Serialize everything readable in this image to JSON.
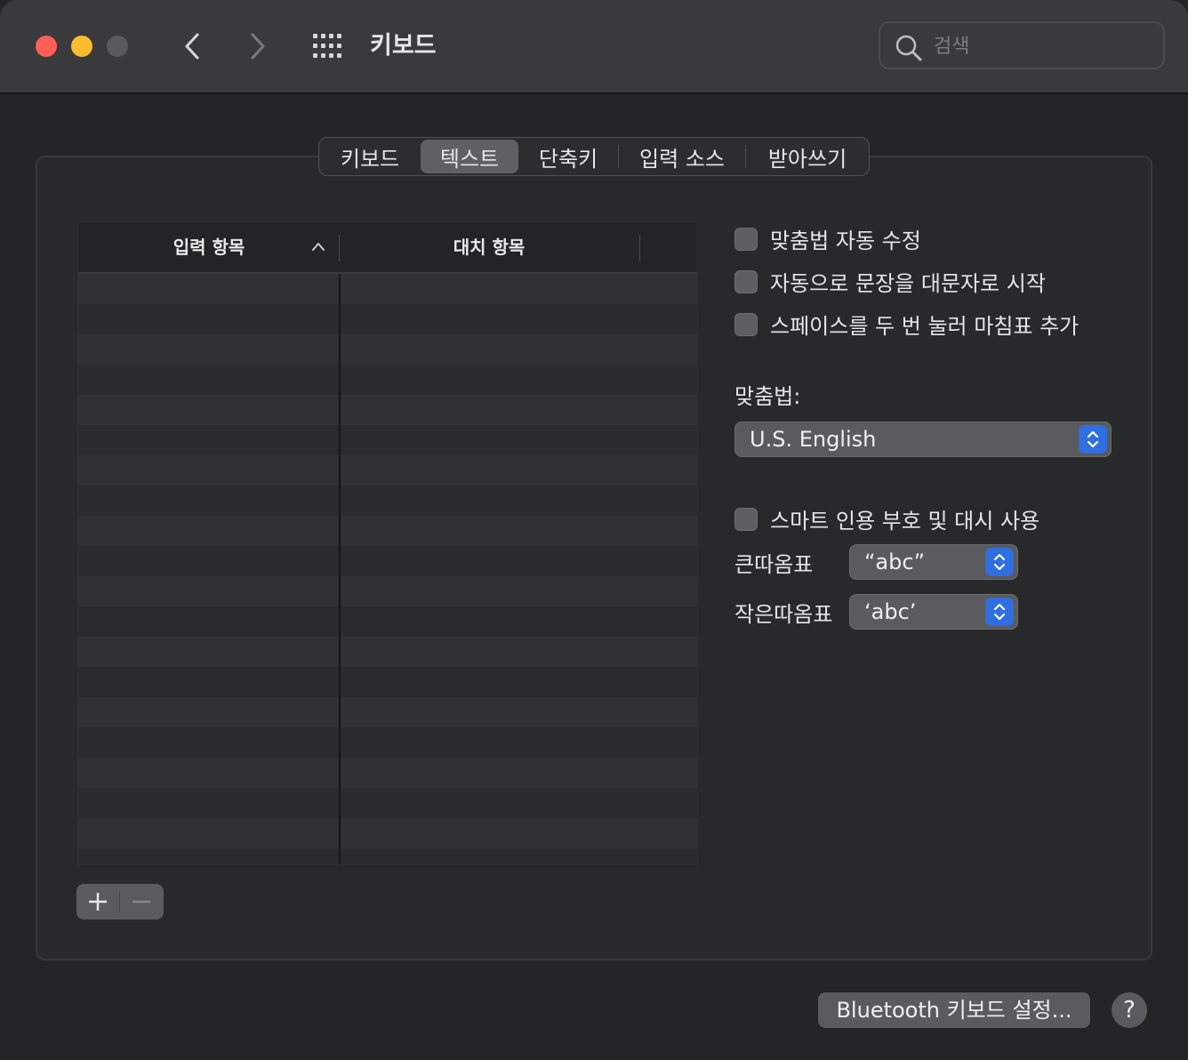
{
  "window": {
    "title": "키보드",
    "search_placeholder": "검색"
  },
  "tabs": [
    {
      "label": "키보드",
      "selected": false
    },
    {
      "label": "텍스트",
      "selected": true
    },
    {
      "label": "단축키",
      "selected": false
    },
    {
      "label": "입력 소스",
      "selected": false
    },
    {
      "label": "받아쓰기",
      "selected": false
    }
  ],
  "table": {
    "columns": [
      "입력 항목",
      "대치 항목"
    ],
    "rows": []
  },
  "buttons": {
    "add": "+",
    "remove": "—"
  },
  "options": {
    "spelling_autocorrect": {
      "label": "맞춤법 자동 수정",
      "checked": false
    },
    "auto_capitalize": {
      "label": "자동으로 문장을 대문자로 시작",
      "checked": false
    },
    "double_space_period": {
      "label": "스페이스를 두 번 눌러 마침표 추가",
      "checked": false
    },
    "smart_quotes": {
      "label": "스마트 인용 부호 및 대시 사용",
      "checked": false
    }
  },
  "spelling": {
    "label": "맞춤법:",
    "value": "U.S. English"
  },
  "quotes": {
    "double_label": "큰따옴표",
    "double_value": "“abc”",
    "single_label": "작은따옴표",
    "single_value": "‘abc’"
  },
  "footer": {
    "bluetooth_button": "Bluetooth 키보드 설정...",
    "help": "?"
  },
  "colors": {
    "close": "#ff5f57",
    "minimize": "#febc2e",
    "accent": "#2f6fdf"
  }
}
